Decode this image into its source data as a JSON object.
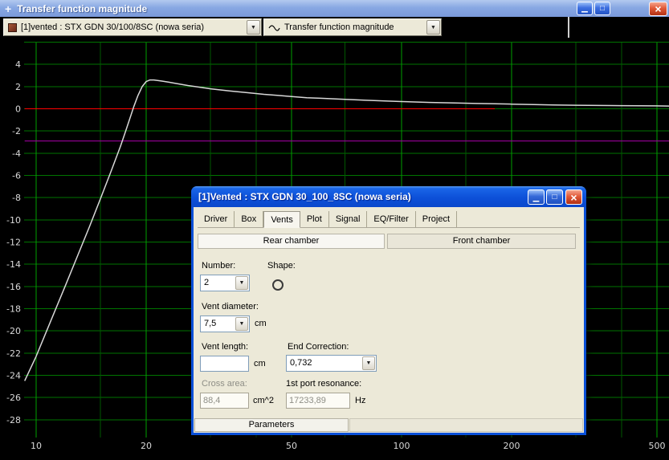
{
  "glyphs": {
    "minimize": "▁",
    "maximize": "□",
    "close": "×",
    "dropdown": "▼",
    "move": "+"
  },
  "window": {
    "title": "Transfer function magnitude"
  },
  "toolbar": {
    "project_combo": {
      "value": "[1]vented : STX GDN 30/100/8SC (nowa seria)"
    },
    "plot_combo": {
      "value": "Transfer function magnitude"
    }
  },
  "chart_data": {
    "type": "line",
    "title": "Transfer function magnitude",
    "x_axis": {
      "scale": "log",
      "unit": "Hz",
      "ticks": [
        10,
        20,
        50,
        100,
        200,
        500
      ],
      "minor_ticks": [
        15,
        30,
        40,
        70,
        150,
        300,
        400
      ],
      "range": [
        9.3,
        540
      ]
    },
    "y_axis": {
      "unit": "dB",
      "ticks": [
        4,
        2,
        0,
        -2,
        -4,
        -6,
        -8,
        -10,
        -12,
        -14,
        -16,
        -18,
        -20,
        -22,
        -24,
        -26,
        -28
      ],
      "range": [
        -29.6,
        6
      ]
    },
    "grid": {
      "h_color": "#007400",
      "major_color": "#00A000",
      "minor_color": "#005800",
      "background": "#000000"
    },
    "label_color": "#D9D9D9",
    "series": [
      {
        "name": "minus-3dB-line",
        "color": "#AA00AA",
        "width": 1,
        "points": [
          [
            9.3,
            -2.9
          ],
          [
            540,
            -2.9
          ]
        ]
      },
      {
        "name": "zero-dB-line",
        "color": "#FF0000",
        "width": 1,
        "points": [
          [
            9.3,
            0
          ],
          [
            180,
            0
          ]
        ]
      },
      {
        "name": "transfer-function",
        "color": "#D8D8D8",
        "width": 1.5,
        "points": [
          [
            9.3,
            -24.5
          ],
          [
            10,
            -22.3
          ],
          [
            11,
            -19
          ],
          [
            12,
            -16
          ],
          [
            13,
            -13.2
          ],
          [
            14,
            -10.6
          ],
          [
            15,
            -8.1
          ],
          [
            16,
            -5.7
          ],
          [
            17,
            -3.4
          ],
          [
            17.5,
            -2.2
          ],
          [
            18,
            -1
          ],
          [
            18.5,
            0.2
          ],
          [
            19,
            1.2
          ],
          [
            19.5,
            2
          ],
          [
            20,
            2.45
          ],
          [
            20.5,
            2.6
          ],
          [
            21,
            2.6
          ],
          [
            22,
            2.5
          ],
          [
            23,
            2.4
          ],
          [
            24,
            2.3
          ],
          [
            26,
            2.1
          ],
          [
            28,
            1.95
          ],
          [
            30,
            1.8
          ],
          [
            34,
            1.6
          ],
          [
            38,
            1.45
          ],
          [
            42,
            1.3
          ],
          [
            46,
            1.2
          ],
          [
            50,
            1.1
          ],
          [
            55,
            1
          ],
          [
            60,
            0.95
          ],
          [
            70,
            0.85
          ],
          [
            80,
            0.77
          ],
          [
            90,
            0.7
          ],
          [
            100,
            0.65
          ],
          [
            120,
            0.57
          ],
          [
            140,
            0.52
          ],
          [
            160,
            0.48
          ],
          [
            180,
            0.45
          ],
          [
            200,
            0.42
          ],
          [
            230,
            0.38
          ],
          [
            260,
            0.35
          ],
          [
            300,
            0.32
          ],
          [
            350,
            0.3
          ],
          [
            400,
            0.28
          ],
          [
            450,
            0.27
          ],
          [
            500,
            0.26
          ],
          [
            540,
            0.25
          ]
        ]
      }
    ]
  },
  "dialog": {
    "title": "[1]Vented : STX GDN 30_100_8SC (nowa seria)",
    "tabs": [
      "Driver",
      "Box",
      "Vents",
      "Plot",
      "Signal",
      "EQ/Filter",
      "Project"
    ],
    "active_tab": "Vents",
    "chambers": {
      "rear": "Rear chamber",
      "front": "Front chamber"
    },
    "fields": {
      "number": {
        "label": "Number:",
        "value": "2"
      },
      "shape": {
        "label": "Shape:"
      },
      "vent_diameter": {
        "label": "Vent diameter:",
        "value": "7,5",
        "unit": "cm"
      },
      "vent_length": {
        "label": "Vent length:",
        "value": "",
        "unit": "cm"
      },
      "end_correction": {
        "label": "End Correction:",
        "value": "0,732"
      },
      "cross_area": {
        "label": "Cross area:",
        "value": "88,4",
        "unit": "cm^2"
      },
      "first_port_resonance": {
        "label": "1st port resonance:",
        "value": "17233,89",
        "unit": "Hz"
      }
    },
    "bottom_bar": "Parameters"
  }
}
